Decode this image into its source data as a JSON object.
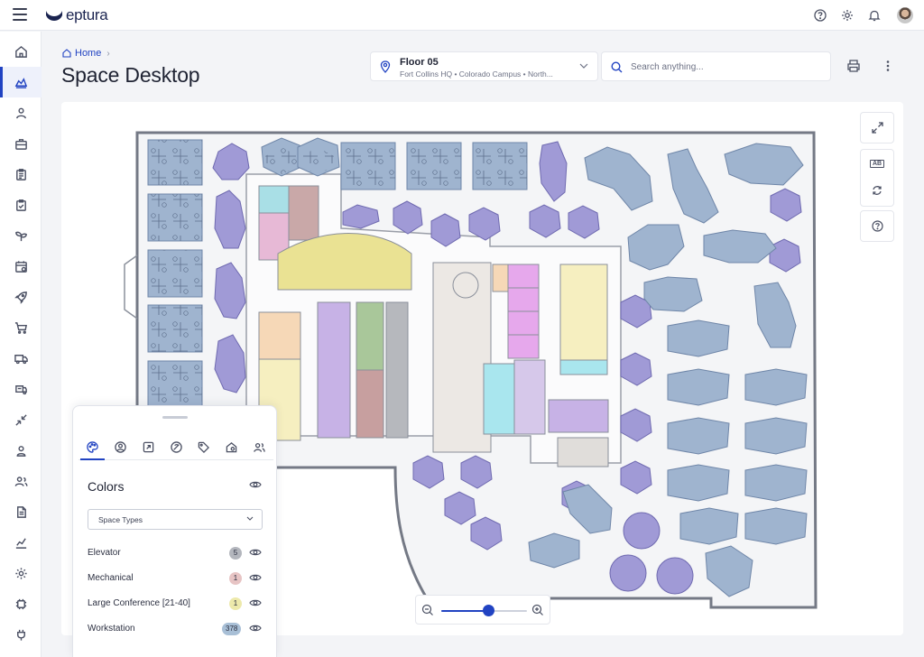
{
  "app": {
    "brand": "eptura"
  },
  "header": {
    "breadcrumb_home": "Home",
    "page_title": "Space Desktop"
  },
  "floor": {
    "name": "Floor 05",
    "location": "Fort Collins HQ • Colorado Campus • North..."
  },
  "search": {
    "placeholder": "Search anything..."
  },
  "top_icons": [
    "help-circle-icon",
    "gear-icon",
    "bell-icon",
    "user-avatar"
  ],
  "sidebar": {
    "items": [
      {
        "name": "home-icon",
        "active": false
      },
      {
        "name": "spaces-icon",
        "active": true
      },
      {
        "name": "people-icon",
        "active": false
      },
      {
        "name": "briefcase-icon",
        "active": false
      },
      {
        "name": "clipboard-list-icon",
        "active": false
      },
      {
        "name": "clipboard-check-icon",
        "active": false
      },
      {
        "name": "sprout-icon",
        "active": false
      },
      {
        "name": "calendar-icon",
        "active": false
      },
      {
        "name": "rocket-icon",
        "active": false
      },
      {
        "name": "cart-icon",
        "active": false
      },
      {
        "name": "truck-icon",
        "active": false
      },
      {
        "name": "delivery-icon",
        "active": false
      },
      {
        "name": "shrink-icon",
        "active": false
      },
      {
        "name": "user-badge-icon",
        "active": false
      },
      {
        "name": "users-icon",
        "active": false
      },
      {
        "name": "document-icon",
        "active": false
      },
      {
        "name": "chart-icon",
        "active": false
      },
      {
        "name": "settings-icon",
        "active": false
      },
      {
        "name": "chip-icon",
        "active": false
      },
      {
        "name": "plug-icon",
        "active": false
      }
    ]
  },
  "map_controls": {
    "label_toggle_text": "AB",
    "icons": [
      "expand-icon",
      "label-toggle-icon",
      "refresh-icon",
      "help-icon"
    ]
  },
  "zoom": {
    "level": 0.55
  },
  "panel": {
    "tabs": [
      "palette-icon",
      "person-icon",
      "rocket-icon",
      "no-booking-icon",
      "tag-icon",
      "home-settings-icon",
      "people-icon"
    ],
    "active_tab": 0,
    "title": "Colors",
    "select_value": "Space Types",
    "legend": [
      {
        "label": "Elevator",
        "count": "5",
        "color": "#b3b6bd"
      },
      {
        "label": "Mechanical",
        "count": "1",
        "color": "#e7c4c4"
      },
      {
        "label": "Large Conference [21-40]",
        "count": "1",
        "color": "#ede9ab"
      },
      {
        "label": "Workstation",
        "count": "378",
        "color": "#a8bfd6"
      }
    ]
  },
  "colors": {
    "accent": "#2143c2",
    "workstation": "#9fb4cf",
    "hex_pod": "#a09ad6",
    "conference": "#eae293",
    "pink_room": "#e7b9d6",
    "magenta_room": "#e6a8ec",
    "peach_room": "#f6d8b7",
    "cream_room": "#f6efc0",
    "lavender_room": "#c7b2e6",
    "green_room": "#a9c79a",
    "rose_room": "#c79f9f",
    "cyan_room": "#a9e6ee",
    "grey_room": "#b6b8bd"
  }
}
